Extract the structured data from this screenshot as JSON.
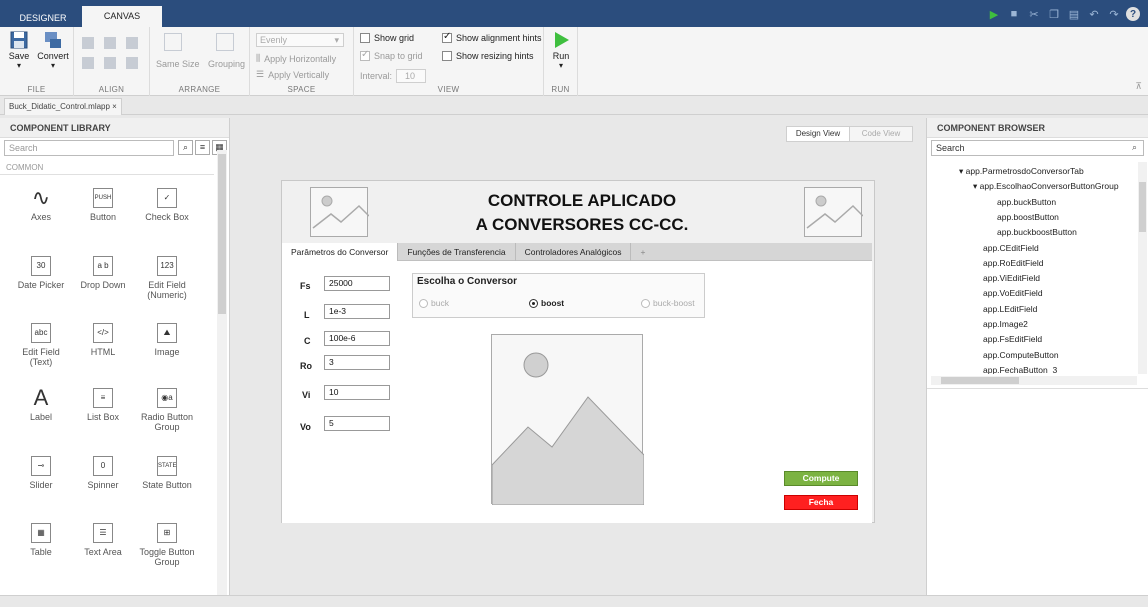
{
  "top_tabs": {
    "designer": "DESIGNER",
    "canvas": "CANVAS"
  },
  "ribbon": {
    "file": {
      "title": "FILE",
      "save": "Save",
      "convert": "Convert"
    },
    "align": {
      "title": "ALIGN"
    },
    "arrange": {
      "title": "ARRANGE",
      "same_size": "Same Size",
      "grouping": "Grouping"
    },
    "space": {
      "title": "SPACE",
      "evenly": "Evenly",
      "apply_h": "Apply Horizontally",
      "apply_v": "Apply Vertically"
    },
    "view": {
      "title": "VIEW",
      "show_grid": "Show grid",
      "snap_to_grid": "Snap to grid",
      "interval_label": "Interval:",
      "interval_value": "10",
      "show_alignment_hints": "Show alignment hints",
      "show_resizing_hints": "Show resizing hints"
    },
    "run": {
      "title": "RUN",
      "run": "Run"
    }
  },
  "file_tab": "Buck_Didatic_Control.mlapp ×",
  "library": {
    "title": "COMPONENT LIBRARY",
    "search_placeholder": "Search",
    "category": "COMMON",
    "items": [
      {
        "label": "Axes",
        "icon": "axes-icon",
        "glyph": "∿"
      },
      {
        "label": "Button",
        "icon": "button-icon",
        "glyph": "PUSH"
      },
      {
        "label": "Check Box",
        "icon": "checkbox-icon",
        "glyph": "✓"
      },
      {
        "label": "Date Picker",
        "icon": "date-picker-icon",
        "glyph": "30"
      },
      {
        "label": "Drop Down",
        "icon": "dropdown-icon",
        "glyph": "a b"
      },
      {
        "label": "Edit Field (Numeric)",
        "icon": "numeric-field-icon",
        "glyph": "123"
      },
      {
        "label": "Edit Field (Text)",
        "icon": "text-field-icon",
        "glyph": "abc"
      },
      {
        "label": "HTML",
        "icon": "html-icon",
        "glyph": "</>"
      },
      {
        "label": "Image",
        "icon": "image-icon",
        "glyph": "⛰"
      },
      {
        "label": "Label",
        "icon": "label-icon",
        "glyph": "A"
      },
      {
        "label": "List Box",
        "icon": "listbox-icon",
        "glyph": "≡"
      },
      {
        "label": "Radio Button Group",
        "icon": "radio-group-icon",
        "glyph": "◉a"
      },
      {
        "label": "Slider",
        "icon": "slider-icon",
        "glyph": "⊸"
      },
      {
        "label": "Spinner",
        "icon": "spinner-icon",
        "glyph": "0"
      },
      {
        "label": "State Button",
        "icon": "state-button-icon",
        "glyph": "STATE"
      },
      {
        "label": "Table",
        "icon": "table-icon",
        "glyph": "▦"
      },
      {
        "label": "Text Area",
        "icon": "textarea-icon",
        "glyph": "☰"
      },
      {
        "label": "Toggle Button Group",
        "icon": "toggle-group-icon",
        "glyph": "⊞"
      }
    ]
  },
  "canvas": {
    "design_view": "Design View",
    "code_view": "Code View",
    "app_title_line1": "CONTROLE APLICADO",
    "app_title_line2": "A CONVERSORES CC-CC.",
    "tabs": [
      "Parâmetros do Conversor",
      "Funções de Transferencia",
      "Controladores Analógicos",
      "+"
    ],
    "fields": [
      {
        "label": "Fs",
        "value": "25000"
      },
      {
        "label": "L",
        "value": "1e-3"
      },
      {
        "label": "C",
        "value": "100e-6"
      },
      {
        "label": "Ro",
        "value": "3"
      },
      {
        "label": "Vi",
        "value": "10"
      },
      {
        "label": "Vo",
        "value": "5"
      }
    ],
    "group_title": "Escolha o Conversor",
    "radios": [
      "buck",
      "boost",
      "buck-boost"
    ],
    "selected_radio": "boost",
    "compute": "Compute",
    "fecha": "Fecha",
    "compute_color": "#7cb342",
    "fecha_color": "#ff2020"
  },
  "browser": {
    "title": "COMPONENT BROWSER",
    "search_placeholder": "Search",
    "tree": [
      {
        "label": "app.ParmetrosdoConversorTab",
        "expanded": true
      },
      {
        "label": "app.EscolhaoConversorButtonGroup",
        "expanded": true
      },
      {
        "label": "app.buckButton"
      },
      {
        "label": "app.boostButton"
      },
      {
        "label": "app.buckboostButton"
      },
      {
        "label": "app.CEditField"
      },
      {
        "label": "app.RoEditField"
      },
      {
        "label": "app.ViEditField"
      },
      {
        "label": "app.VoEditField"
      },
      {
        "label": "app.LEditField"
      },
      {
        "label": "app.Image2"
      },
      {
        "label": "app.FsEditField"
      },
      {
        "label": "app.ComputeButton"
      },
      {
        "label": "app.FechaButton_3"
      }
    ]
  }
}
